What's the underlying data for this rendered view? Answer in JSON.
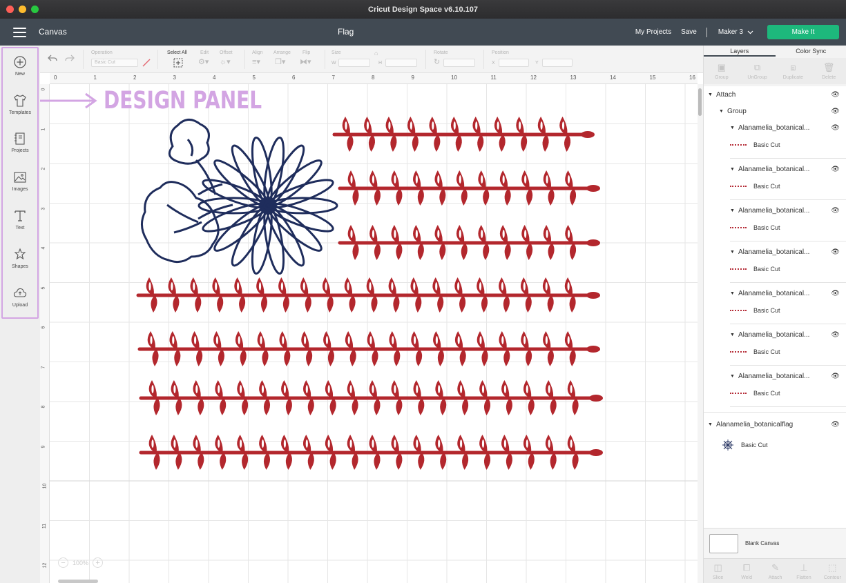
{
  "window": {
    "title": "Cricut Design Space  v6.10.107"
  },
  "header": {
    "section": "Canvas",
    "project_title": "Flag",
    "my_projects": "My Projects",
    "save": "Save",
    "machine": "Maker 3",
    "make_it": "Make It"
  },
  "annotation": {
    "text": "DESIGN PANEL",
    "color": "#d3a5e3"
  },
  "design_panel": {
    "items": [
      {
        "label": "New",
        "icon": "plus-circle-icon"
      },
      {
        "label": "Templates",
        "icon": "shirt-icon"
      },
      {
        "label": "Projects",
        "icon": "projects-icon"
      },
      {
        "label": "Images",
        "icon": "image-icon"
      },
      {
        "label": "Text",
        "icon": "text-icon"
      },
      {
        "label": "Shapes",
        "icon": "shapes-icon"
      },
      {
        "label": "Upload",
        "icon": "upload-cloud-icon"
      }
    ]
  },
  "toolbar": {
    "operation_label": "Operation",
    "operation_value": "Basic Cut",
    "select_all": "Select All",
    "edit": "Edit",
    "offset": "Offset",
    "align": "Align",
    "arrange": "Arrange",
    "flip": "Flip",
    "size": "Size",
    "w": "W",
    "h": "H",
    "rotate": "Rotate",
    "position": "Position",
    "x": "X",
    "y": "Y"
  },
  "rulers": {
    "top": [
      "0",
      "1",
      "2",
      "3",
      "4",
      "5",
      "6",
      "7",
      "8",
      "9",
      "10",
      "11",
      "12",
      "13",
      "14",
      "15",
      "16"
    ],
    "left": [
      "0",
      "1",
      "2",
      "3",
      "4",
      "5",
      "6",
      "7",
      "8",
      "9",
      "10",
      "11",
      "12"
    ]
  },
  "zoom": {
    "value": "100%"
  },
  "layers_panel": {
    "tabs": [
      "Layers",
      "Color Sync"
    ],
    "actions": [
      "Group",
      "UnGroup",
      "Duplicate",
      "Delete"
    ],
    "attach": "Attach",
    "group": "Group",
    "items": [
      {
        "name": "Alanamelia_botanical...",
        "op": "Basic Cut"
      },
      {
        "name": "Alanamelia_botanical...",
        "op": "Basic Cut"
      },
      {
        "name": "Alanamelia_botanical...",
        "op": "Basic Cut"
      },
      {
        "name": "Alanamelia_botanical...",
        "op": "Basic Cut"
      },
      {
        "name": "Alanamelia_botanical...",
        "op": "Basic Cut"
      },
      {
        "name": "Alanamelia_botanical...",
        "op": "Basic Cut"
      },
      {
        "name": "Alanamelia_botanical...",
        "op": "Basic Cut"
      }
    ],
    "flag_layer": {
      "name": "Alanamelia_botanicalflag",
      "op": "Basic Cut"
    },
    "blank_canvas": "Blank Canvas",
    "bottom_actions": [
      "Slice",
      "Weld",
      "Attach",
      "Flatten",
      "Contour"
    ]
  },
  "colors": {
    "header": "#414a53",
    "make_it": "#1db87c",
    "vine_red": "#b3272d",
    "flower_navy": "#1f2d5c"
  }
}
